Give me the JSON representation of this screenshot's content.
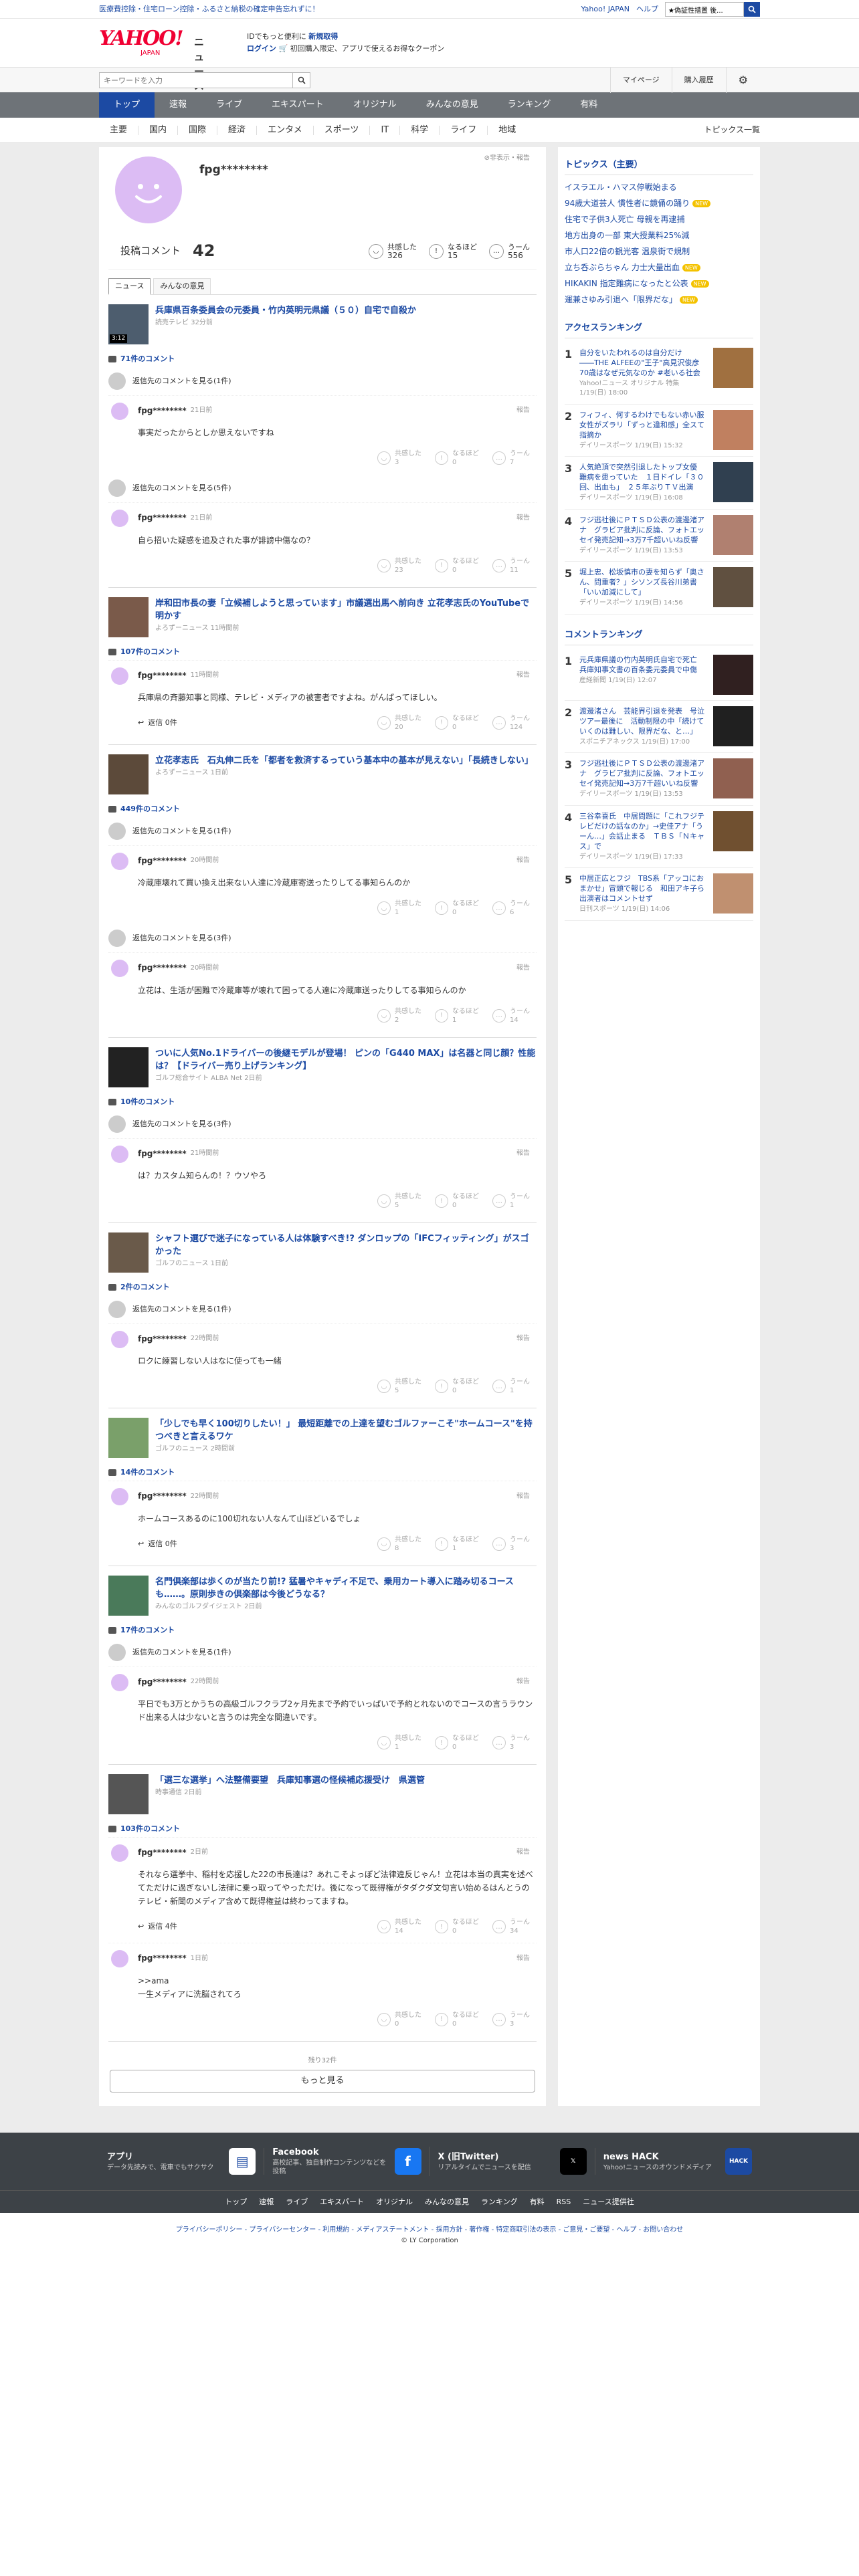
{
  "promo": {
    "left": "医療費控除・住宅ローン控除・ふるさと納税の確定申告忘れずに！",
    "links": [
      "Yahoo! JAPAN",
      "ヘルプ"
    ],
    "search_placeholder": "ウェブ検索",
    "search_value": "★偽証性措置 後..."
  },
  "header": {
    "logo_text": "YAHOO!",
    "logo_sub": "JAPAN",
    "logo_news": "ニュース",
    "msg_line1": "IDでもっと便利に",
    "msg_line1_bold": "新規取得",
    "msg_login": "ログイン",
    "msg_line2": "初回購入限定、アプリで使えるお得なクーポン"
  },
  "toolbar": {
    "keyword_placeholder": "キーワードを入力",
    "mypage": "マイページ",
    "history": "購入履歴"
  },
  "nav1": [
    "トップ",
    "速報",
    "ライブ",
    "エキスパート",
    "オリジナル",
    "みんなの意見",
    "ランキング",
    "有料"
  ],
  "nav2": [
    "主要",
    "国内",
    "国際",
    "経済",
    "エンタメ",
    "スポーツ",
    "IT",
    "科学",
    "ライフ",
    "地域"
  ],
  "nav2_right": "トピックス一覧",
  "profile": {
    "name": "fpg********",
    "report": "非表示・報告",
    "comments_label": "投稿コメント",
    "comments_count": "42",
    "reacts": [
      {
        "icon": "◡",
        "label": "共感した",
        "value": "326"
      },
      {
        "icon": "!",
        "label": "なるほど",
        "value": "15"
      },
      {
        "icon": "…",
        "label": "うーん",
        "value": "556"
      }
    ]
  },
  "tabs": [
    "ニュース",
    "みんなの意見"
  ],
  "labels": {
    "parent": "返信先のコメントを見る",
    "report": "報告",
    "react_labels": [
      "共感した",
      "なるほど",
      "うーん"
    ]
  },
  "articles": [
    {
      "title": "兵庫県百条委員会の元委員・竹内英明元県議（５０）自宅で自殺か",
      "source": "読売テレビ 32分前",
      "duration": "3:12",
      "count_text": "71件のコメント",
      "comments": [
        {
          "parent": "返信先のコメントを見る(1件)",
          "user": "fpg********",
          "time": "21日前",
          "text": "事実だったからとしか思えないですね",
          "reply": "",
          "r": [
            "3",
            "0",
            "7"
          ]
        },
        {
          "parent": "返信先のコメントを見る(5件)",
          "user": "fpg********",
          "time": "21日前",
          "text": "自ら招いた疑惑を追及された事が誹謗中傷なの？",
          "reply": "",
          "r": [
            "23",
            "0",
            "11"
          ]
        }
      ]
    },
    {
      "title": "岸和田市長の妻「立候補しようと思っています」市議選出馬へ前向き 立花孝志氏のYouTubeで明かす",
      "source": "よろずーニュース 11時間前",
      "count_text": "107件のコメント",
      "comments": [
        {
          "parent": "",
          "user": "fpg********",
          "time": "11時間前",
          "text": "兵庫県の斉藤知事と同様、テレビ・メディアの被害者ですよね。がんばってほしい。",
          "reply": "返信 0件",
          "r": [
            "20",
            "0",
            "124"
          ]
        }
      ]
    },
    {
      "title": "立花孝志氏　石丸伸二氏を「都者を救済するっていう基本中の基本が見えない」「長続きしない」",
      "source": "よろずーニュース 1日前",
      "count_text": "449件のコメント",
      "comments": [
        {
          "parent": "返信先のコメントを見る(1件)",
          "user": "fpg********",
          "time": "20時間前",
          "text": "冷蔵庫壊れて買い換え出来ない人達に冷蔵庫寄送ったりしてる事知らんのか",
          "reply": "",
          "r": [
            "1",
            "0",
            "6"
          ]
        },
        {
          "parent": "返信先のコメントを見る(3件)",
          "user": "fpg********",
          "time": "20時間前",
          "text": "立花は、生活が困難で冷蔵庫等が壊れて困ってる人達に冷蔵庫送ったりしてる事知らんのか",
          "reply": "",
          "r": [
            "2",
            "1",
            "14"
          ]
        }
      ]
    },
    {
      "title": "ついに人気No.1ドライバーの後継モデルが登場！ ピンの「G440 MAX」は名器と同じ顔？性能は？【ドライバー売り上げランキング】",
      "source": "ゴルフ総合サイト ALBA Net 2日前",
      "count_text": "10件のコメント",
      "comments": [
        {
          "parent": "返信先のコメントを見る(3件)",
          "user": "fpg********",
          "time": "21時間前",
          "text": "は？カスタム知らんの！？ウソやろ",
          "reply": "",
          "r": [
            "5",
            "0",
            "1"
          ]
        }
      ]
    },
    {
      "title": "シャフト選びで迷子になっている人は体験すべき!? ダンロップの「IFCフィッティング」がスゴかった",
      "source": "ゴルフのニュース 1日前",
      "count_text": "2件のコメント",
      "comments": [
        {
          "parent": "返信先のコメントを見る(1件)",
          "user": "fpg********",
          "time": "22時間前",
          "text": "ロクに練習しない人はなに使っても一緒",
          "reply": "",
          "r": [
            "5",
            "0",
            "1"
          ]
        }
      ]
    },
    {
      "title": "「少しでも早く100切りしたい！」 最短距離での上達を望むゴルファーこそ\"ホームコース\"を持つべきと言えるワケ",
      "source": "ゴルフのニュース 2時間前",
      "count_text": "14件のコメント",
      "comments": [
        {
          "parent": "",
          "user": "fpg********",
          "time": "22時間前",
          "text": "ホームコースあるのに100切れない人なんて山ほどいるでしょ",
          "reply": "返信 0件",
          "r": [
            "8",
            "1",
            "3"
          ]
        }
      ]
    },
    {
      "title": "名門倶楽部は歩くのが当たり前!? 猛暑やキャディ不足で、乗用カート導入に踏み切るコースも……。原則歩きの倶楽部は今後どうなる？",
      "source": "みんなのゴルフダイジェスト 2日前",
      "count_text": "17件のコメント",
      "comments": [
        {
          "parent": "返信先のコメントを見る(1件)",
          "user": "fpg********",
          "time": "22時間前",
          "text": "平日でも3万とかうちの高級ゴルフクラブ2ヶ月先まで予約でいっぱいで予約とれないのでコースの言うラウンド出来る人は少ないと言うのは完全な間違いです。",
          "reply": "",
          "r": [
            "1",
            "0",
            "3"
          ]
        }
      ]
    },
    {
      "title": "「選三な選挙」へ法整備要望　兵庫知事選の怪候補応援受け　県選管",
      "source": "時事通信 2日前",
      "count_text": "103件のコメント",
      "comments": [
        {
          "parent": "",
          "user": "fpg********",
          "time": "2日前",
          "text": "それなら選挙中、稲村を応援した22の市長達は？あれこそよっぽど法律違反じゃん！立花は本当の真実を述べてただけに過ぎないし法律に乗っ取ってやっただけ。後になって既得権がタダクダ文句言い始めるはんとうのテレビ・新聞のメディア含めて既得権益は終わってますね。",
          "reply": "返信 4件",
          "r": [
            "14",
            "0",
            "34"
          ]
        },
        {
          "parent": "",
          "user": "fpg********",
          "time": "1日前",
          "text": ">>ama\n一生メディアに洗脳されてろ",
          "reply": "",
          "r": [
            "0",
            "0",
            "3"
          ]
        }
      ]
    }
  ],
  "more": {
    "remain": "残り32件",
    "button": "もっと見る"
  },
  "side": {
    "topics_title": "トピックス（主要）",
    "topics": [
      {
        "t": "イスラエル・ハマス停戦始まる",
        "new": false
      },
      {
        "t": "94歳大道芸人 慣性者に鏡俑の踊り",
        "new": true
      },
      {
        "t": "住宅で子供3人死亡 母親を再逮捕",
        "new": false
      },
      {
        "t": "地方出身の一部 東大授業料25%減",
        "new": false
      },
      {
        "t": "市人口22倍の観光客 温泉街で規制",
        "new": false
      },
      {
        "t": "立ち呑ぶらちゃん 力士大量出血",
        "new": true
      },
      {
        "t": "HIKAKIN 指定難病になったと公表",
        "new": true
      },
      {
        "t": "運兼さゆみ引退へ「限界だな」",
        "new": true
      }
    ],
    "new_label": "NEW",
    "access_title": "アクセスランキング",
    "access": [
      {
        "n": "1",
        "t": "自分をいたわれるのは自分だけ――THE ALFEEの\"王子\"高見沢俊彦70歳はなぜ元気なのか #老いる社会",
        "s": "Yahoo!ニュース オリジナル 特集 1/19(日) 18:00"
      },
      {
        "n": "2",
        "t": "フィフィ、何するわけでもない赤い服女性がズラリ「ずっと違和感」全スて指摘か",
        "s": "デイリースポーツ 1/19(日) 15:32"
      },
      {
        "n": "3",
        "t": "人気絶頂で突然引退したトップ女優　難病を患っていた　１日ドイレ「３０回、出血も」　２５年ぶりＴＶ出演",
        "s": "デイリースポーツ 1/19(日) 16:08"
      },
      {
        "n": "4",
        "t": "フジ逃社後にＰＴＳＤ公表の渡邊渚アナ　グラビア批判に反論、フォトエッセイ発売記知→3万7千超いいね反響",
        "s": "デイリースポーツ 1/19(日) 13:53"
      },
      {
        "n": "5",
        "t": "堀上忠、松坂慎市の妻を知らず「奥さん、問重者？」シソンズ長谷川弟書「いい加減にして」",
        "s": "デイリースポーツ 1/19(日) 14:56"
      }
    ],
    "comment_title": "コメントランキング",
    "comment": [
      {
        "n": "1",
        "t": "元兵庫県議の竹内英明氏自宅で死亡　兵庫知事文書の百条委元委員で中傷",
        "s": "産経新聞 1/19(日) 12:07"
      },
      {
        "n": "2",
        "t": "渡邊渚さん　芸能界引退を発表　号泣ツアー最後に　活動制限の中「続けていくのは難しい、限界だな、と…」",
        "s": "スポニチアネックス 1/19(日) 17:00"
      },
      {
        "n": "3",
        "t": "フジ逃社後にＰＴＳＤ公表の渡邊渚アナ　グラビア批判に反論、フォトエッセイ発売記知→3万7千超いいね反響",
        "s": "デイリースポーツ 1/19(日) 13:53"
      },
      {
        "n": "4",
        "t": "三谷幸喜氏　中居問題に「これフジテレビだけの話なのか」→史佳アナ「うーん…」会話止まる　ＴＢＳ「Ｎキャス」で",
        "s": "デイリースポーツ 1/19(日) 17:33"
      },
      {
        "n": "5",
        "t": "中居正広とフジ　TBS系「アッコにおまかせ」冒頭で報じる　和田アキ子ら出演者はコメントせず",
        "s": "日刊スポーツ 1/19(日) 14:06"
      }
    ]
  },
  "footer": {
    "cols": [
      {
        "t": "アプリ",
        "d": "データ先読みで、電車でもサクサク",
        "icon": "app-icon",
        "glyph": "▤",
        "bg": "#ffffff",
        "fg": "#1c4aa3"
      },
      {
        "t": "Facebook",
        "d": "高校記事、独自制作コンテンツなどを投稿",
        "icon": "facebook-icon",
        "glyph": "f",
        "bg": "#1877f2",
        "fg": "#ffffff"
      },
      {
        "t": "X (旧Twitter)",
        "d": "リアルタイムでニュースを配信",
        "icon": "x-icon",
        "glyph": "𝕏",
        "bg": "#000000",
        "fg": "#ffffff"
      },
      {
        "t": "news HACK",
        "d": "Yahoo!ニュースのオウンドメディア",
        "icon": "news-hack-icon",
        "glyph": "HACK",
        "bg": "#1c4aa3",
        "fg": "#ffffff"
      }
    ],
    "nav": [
      "トップ",
      "速報",
      "ライブ",
      "エキスパート",
      "オリジナル",
      "みんなの意見",
      "ランキング",
      "有料",
      "RSS",
      "ニュース提供社"
    ],
    "legal1": "プライバシーポリシー - プライバシーセンター - 利用規約 - メディアステートメント - 採用方針 - 著作権 - 特定商取引法の表示 - ご意見・ご要望 - ヘルプ - お問い合わせ",
    "copyright": "© LY Corporation"
  }
}
